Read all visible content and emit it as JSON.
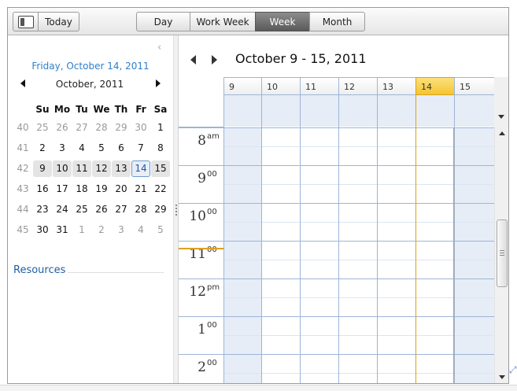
{
  "toolbar": {
    "toggle_icon": "sidebar-toggle-icon",
    "today_label": "Today",
    "views": [
      {
        "label": "Day",
        "active": false
      },
      {
        "label": "Work Week",
        "active": false
      },
      {
        "label": "Week",
        "active": true
      },
      {
        "label": "Month",
        "active": false
      }
    ]
  },
  "sidebar": {
    "selected_date": "Friday, October 14, 2011",
    "calendar": {
      "month_label": "October, 2011",
      "day_names": [
        "Su",
        "Mo",
        "Tu",
        "We",
        "Th",
        "Fr",
        "Sa"
      ],
      "weeks": [
        {
          "num": "40",
          "days": [
            {
              "d": "25",
              "other": true
            },
            {
              "d": "26",
              "other": true
            },
            {
              "d": "27",
              "other": true
            },
            {
              "d": "28",
              "other": true
            },
            {
              "d": "29",
              "other": true
            },
            {
              "d": "30",
              "other": true
            },
            {
              "d": "1"
            }
          ]
        },
        {
          "num": "41",
          "days": [
            {
              "d": "2"
            },
            {
              "d": "3"
            },
            {
              "d": "4"
            },
            {
              "d": "5"
            },
            {
              "d": "6"
            },
            {
              "d": "7"
            },
            {
              "d": "8"
            }
          ]
        },
        {
          "num": "42",
          "days": [
            {
              "d": "9",
              "inweek": true
            },
            {
              "d": "10",
              "inweek": true
            },
            {
              "d": "11",
              "inweek": true
            },
            {
              "d": "12",
              "inweek": true
            },
            {
              "d": "13",
              "inweek": true
            },
            {
              "d": "14",
              "selected": true
            },
            {
              "d": "15",
              "inweek": true
            }
          ]
        },
        {
          "num": "43",
          "days": [
            {
              "d": "16"
            },
            {
              "d": "17"
            },
            {
              "d": "18"
            },
            {
              "d": "19"
            },
            {
              "d": "20"
            },
            {
              "d": "21"
            },
            {
              "d": "22"
            }
          ]
        },
        {
          "num": "44",
          "days": [
            {
              "d": "23"
            },
            {
              "d": "24"
            },
            {
              "d": "25"
            },
            {
              "d": "26"
            },
            {
              "d": "27"
            },
            {
              "d": "28"
            },
            {
              "d": "29"
            }
          ]
        },
        {
          "num": "45",
          "days": [
            {
              "d": "30"
            },
            {
              "d": "31"
            },
            {
              "d": "1",
              "other": true
            },
            {
              "d": "2",
              "other": true
            },
            {
              "d": "3",
              "other": true
            },
            {
              "d": "4",
              "other": true
            },
            {
              "d": "5",
              "other": true
            }
          ]
        }
      ]
    },
    "resources_label": "Resources"
  },
  "scheduler": {
    "range_label": "October 9 - 15, 2011",
    "days": [
      {
        "num": "9",
        "weekend": true,
        "today": false
      },
      {
        "num": "10",
        "weekend": false,
        "today": false
      },
      {
        "num": "11",
        "weekend": false,
        "today": false
      },
      {
        "num": "12",
        "weekend": false,
        "today": false
      },
      {
        "num": "13",
        "weekend": false,
        "today": false
      },
      {
        "num": "14",
        "weekend": false,
        "today": true
      },
      {
        "num": "15",
        "weekend": true,
        "today": false
      }
    ],
    "hours": [
      {
        "h": "8",
        "m": "am"
      },
      {
        "h": "9",
        "m": "00"
      },
      {
        "h": "10",
        "m": "00"
      },
      {
        "h": "11",
        "m": "00"
      },
      {
        "h": "12",
        "m": "pm"
      },
      {
        "h": "1",
        "m": "00"
      },
      {
        "h": "2",
        "m": "00"
      }
    ]
  },
  "colors": {
    "accent_blue": "#2f7fc8",
    "today_highlight": "#f4c534",
    "weekend_fill": "#e6edf7",
    "grid_line": "#9db5d6",
    "current_time": "#e0a020"
  }
}
